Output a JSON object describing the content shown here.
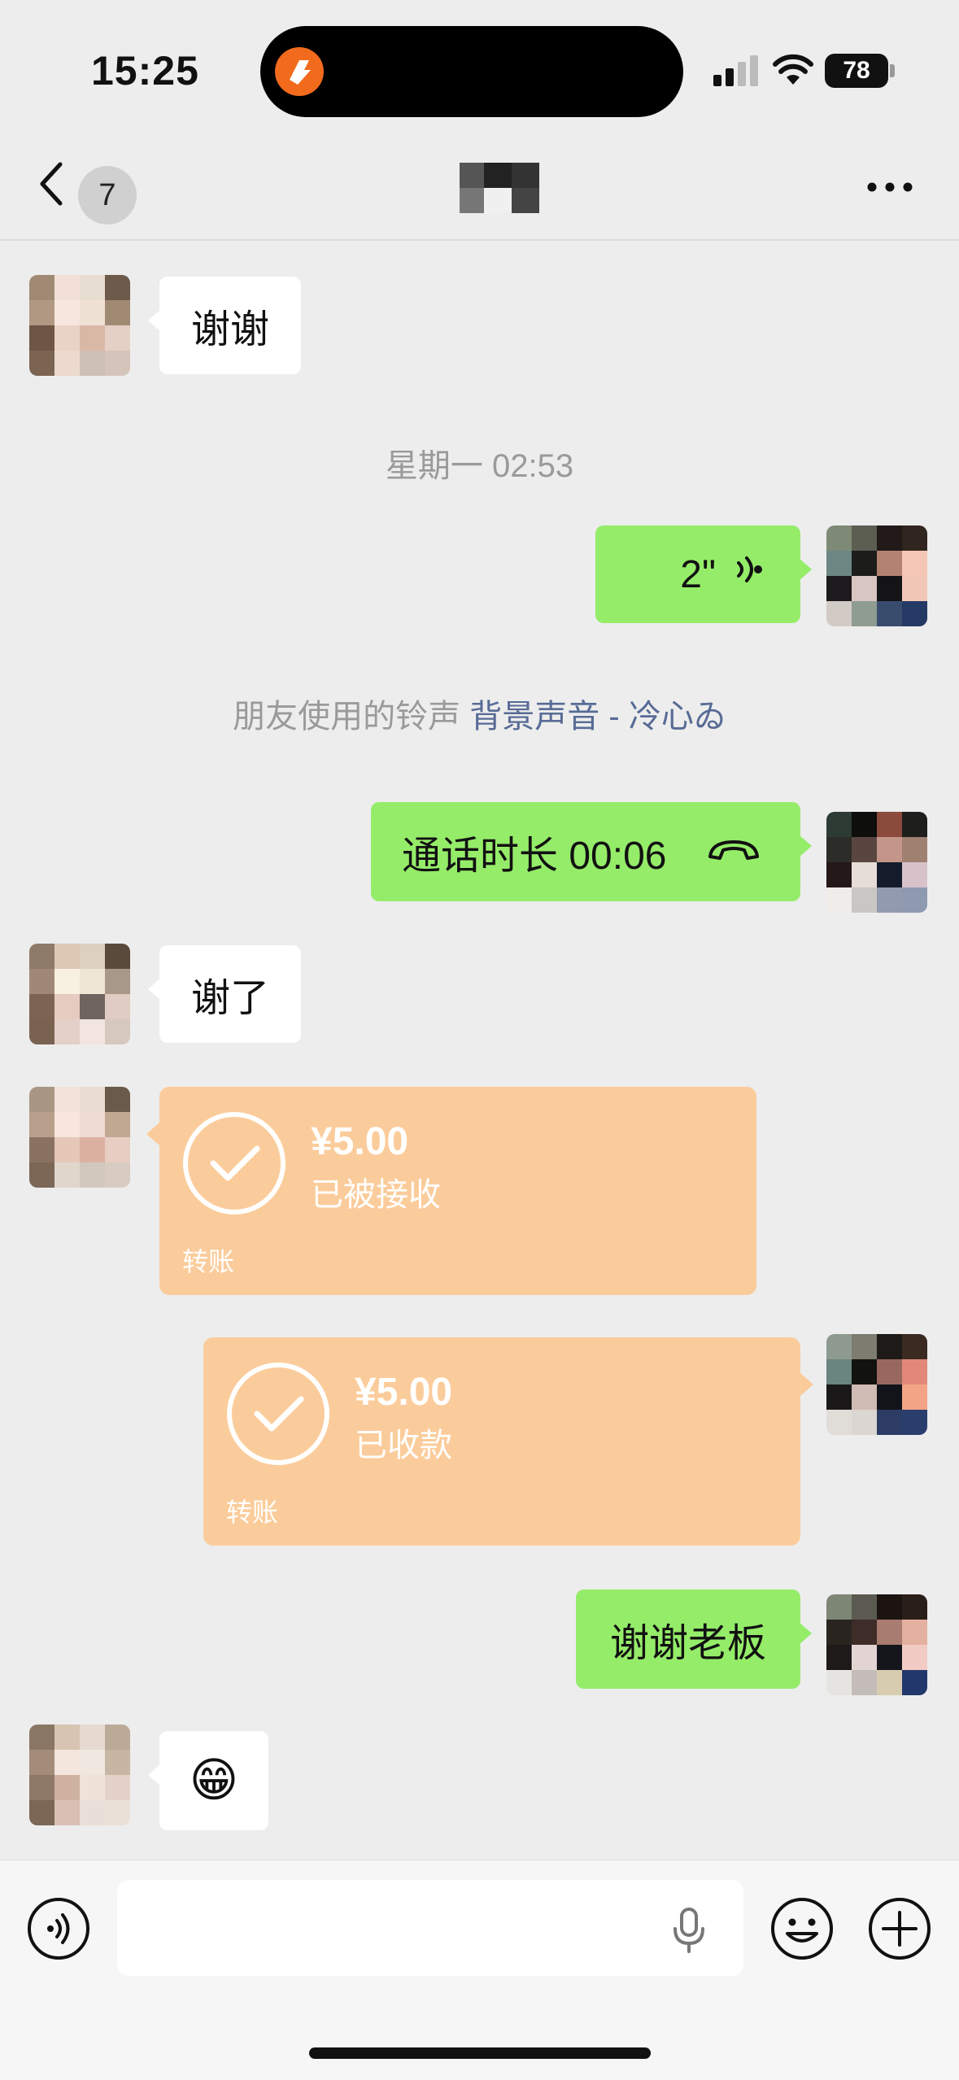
{
  "status_bar": {
    "time": "15:25",
    "battery": "78"
  },
  "header": {
    "unread_count": "7"
  },
  "messages": {
    "m1_text": "谢谢",
    "timestamp": "星期一 02:53",
    "voice_duration": "2\"",
    "ringtone_prefix": "朋友使用的铃声",
    "ringtone_song": "背景声音 - 冷心ゐ",
    "call_text": "通话时长 00:06",
    "m2_text": "谢了",
    "transfer1_amount": "¥5.00",
    "transfer1_status": "已被接收",
    "transfer1_label": "转账",
    "transfer2_amount": "¥5.00",
    "transfer2_status": "已收款",
    "transfer2_label": "转账",
    "m3_text": "谢谢老板",
    "m4_emoji": "😁"
  },
  "colors": {
    "chat_bg": "#ededed",
    "bubble_self": "#95ec69",
    "bubble_other": "#ffffff",
    "transfer_card": "#fbcc9b",
    "link": "#576b95"
  },
  "icons": {
    "back": "chevron-left-icon",
    "more": "more-dots-icon",
    "voice": "voice-wave-icon",
    "call": "phone-hangup-icon",
    "check": "check-circle-icon",
    "voice_toggle": "voice-toggle-icon",
    "mic": "microphone-icon",
    "emoji": "emoji-icon",
    "plus": "plus-circle-icon"
  }
}
